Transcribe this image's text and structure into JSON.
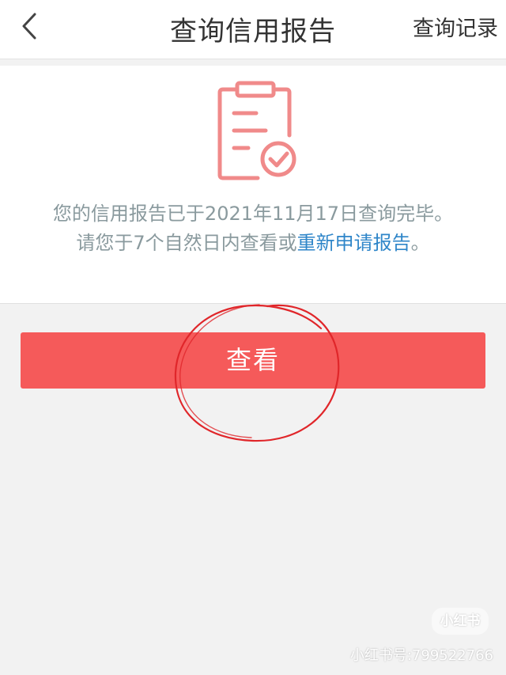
{
  "header": {
    "back_icon": "chevron-left-icon",
    "title": "查询信用报告",
    "action_label": "查询记录"
  },
  "status_card": {
    "icon": "report-check-icon",
    "message_line1": "您的信用报告已于2021年11月17日查询完毕。",
    "message_line2_prefix": "请您于7个自然日内查看或",
    "reapply_link": "重新申请报告",
    "message_line2_suffix": "。"
  },
  "primary_button": {
    "label": "查看"
  },
  "watermark": {
    "logo_text": "小红书",
    "id_text": "小红书号:799522766"
  },
  "colors": {
    "accent_red": "#f55a5a",
    "icon_red": "#f08a8a",
    "link_blue": "#2f86c9",
    "message_gray": "#8a9a9e",
    "annotation_red": "#e0262a"
  }
}
